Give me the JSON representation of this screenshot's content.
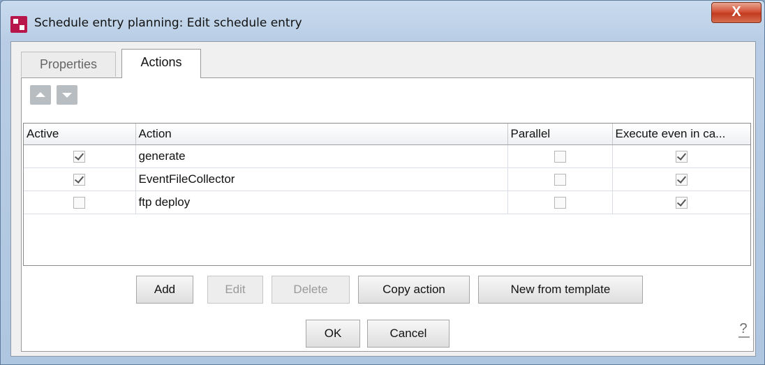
{
  "window": {
    "title": "Schedule entry planning:  Edit schedule entry",
    "close_glyph": "X"
  },
  "tabs": [
    {
      "label": "Properties",
      "selected": false
    },
    {
      "label": "Actions",
      "selected": true
    }
  ],
  "table": {
    "columns": [
      "Active",
      "Action",
      "Parallel",
      "Execute even in ca..."
    ],
    "rows": [
      {
        "active": true,
        "action": "generate",
        "parallel": false,
        "execute": true
      },
      {
        "active": true,
        "action": "EventFileCollector",
        "parallel": false,
        "execute": true
      },
      {
        "active": false,
        "action": "ftp deploy",
        "parallel": false,
        "execute": true
      }
    ]
  },
  "action_buttons": {
    "add": "Add",
    "edit": "Edit",
    "delete": "Delete",
    "copy": "Copy action",
    "new_from_template": "New from template"
  },
  "dialog_buttons": {
    "ok": "OK",
    "cancel": "Cancel"
  },
  "help": "?"
}
